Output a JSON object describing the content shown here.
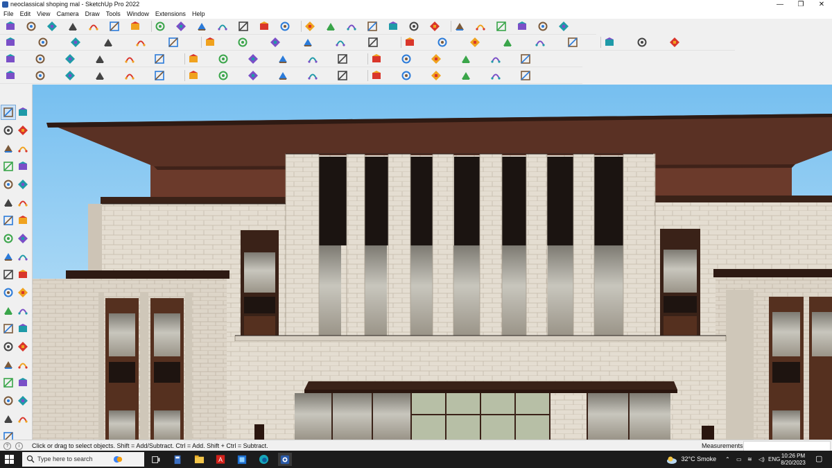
{
  "window": {
    "title": "neoclassical shoping mal - SketchUp Pro 2022",
    "controls": [
      "—",
      "❐",
      "✕"
    ]
  },
  "menu": [
    "File",
    "Edit",
    "View",
    "Camera",
    "Draw",
    "Tools",
    "Window",
    "Extensions",
    "Help"
  ],
  "toolbars": {
    "row1": [
      "zoom-extents",
      "select",
      "eraser",
      "line",
      "arc",
      "rectangle",
      "push-pull",
      "move",
      "rotate",
      "scale",
      "offset",
      "tape-measure",
      "text",
      "paint-bucket",
      "orbit",
      "pan",
      "zoom",
      "zoom-window",
      "section-plane",
      "layers",
      "components",
      "warehouse",
      "styles",
      "shadows",
      "fog",
      "match-photo",
      "sandbox"
    ],
    "row2": [
      "iso-view",
      "top-view",
      "front-view",
      "right-view",
      "back-view",
      "left-view",
      "xray",
      "wireframe",
      "hidden-line",
      "shaded",
      "textured",
      "monochrome",
      "edges",
      "outer-shell",
      "intersect",
      "union",
      "subtract",
      "trim",
      "split",
      "follow-me",
      "solid-inspector"
    ],
    "row3": [
      "extrude",
      "curviloft",
      "bezier",
      "fillet",
      "chamfer",
      "round-corner",
      "shape-bender",
      "flowify",
      "joint-push-pull",
      "vertex-tools",
      "fredo-scale",
      "selection-toys",
      "label-stray",
      "cleanup",
      "weld",
      "make-face",
      "soap-skin",
      "sandbox-drape"
    ],
    "row4": [
      "bezier-spline",
      "polyline",
      "catmull",
      "cubic",
      "b-spline",
      "divider",
      "offset-curve",
      "extrude-edges",
      "tools-on-surface",
      "tube-along",
      "profile-builder",
      "roof",
      "stairs",
      "window-tool",
      "door-tool",
      "railing",
      "array",
      "mirror"
    ]
  },
  "left_tools": [
    "select",
    "orbit",
    "paint-bucket",
    "eraser",
    "component",
    "tag",
    "line",
    "freehand",
    "rectangle",
    "rotated-rect",
    "circle",
    "polygon",
    "arc",
    "pie",
    "offset",
    "follow-me",
    "push-pull",
    "move",
    "rotate",
    "scale",
    "tape-measure",
    "text",
    "protractor",
    "dimension",
    "axes",
    "3d-text",
    "orbit-2",
    "pan",
    "zoom",
    "zoom-window",
    "zoom-extents",
    "previous-view",
    "position-camera",
    "look-around",
    "walk",
    "section-plane",
    "section-display"
  ],
  "status": {
    "message": "Click or drag to select objects. Shift = Add/Subtract. Ctrl = Add. Shift + Ctrl = Subtract.",
    "measurements_label": "Measurements",
    "measurements_value": ""
  },
  "taskbar": {
    "search_placeholder": "Type here to search",
    "weather": "32°C  Smoke",
    "language": "ENG",
    "time": "10:26 PM",
    "date": "8/20/2023"
  },
  "colors": {
    "sky": "#8ecbef",
    "roof": "#5e3426",
    "stone": "#e3dbcf",
    "glass": "#b9b5a8",
    "accent": "#2a5aa8"
  }
}
